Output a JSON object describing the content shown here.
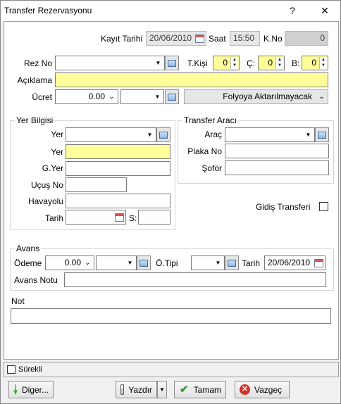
{
  "window": {
    "title": "Transfer Rezervasyonu",
    "help_glyph": "?",
    "close_glyph": "✕"
  },
  "header": {
    "kayit_tarihi_label": "Kayıt Tarihi",
    "kayit_tarihi_value": "20/06/2010",
    "saat_label": "Saat",
    "saat_value": "15:50",
    "kno_label": "K.No",
    "kno_value": "0"
  },
  "rez": {
    "rezno_label": "Rez No",
    "rezno_value": "",
    "tkisi_label": "T.Kişi",
    "tkisi_value": "0",
    "c_label": "Ç:",
    "c_value": "0",
    "b_label": "B:",
    "b_value": "0"
  },
  "aciklama": {
    "label": "Açıklama",
    "value": ""
  },
  "ucret": {
    "label": "Ücret",
    "amount": "0.00",
    "currency": "",
    "folyo_value": "Folyoya Aktarılmayacak"
  },
  "yer_bilgisi": {
    "title": "Yer Bilgisi",
    "yer_label": "Yer",
    "yer_select": "",
    "yer2_label": "Yer",
    "yer2_value": "",
    "gyer_label": "G.Yer",
    "gyer_value": "",
    "ucusno_label": "Uçuş No",
    "ucusno_value": "",
    "havayolu_label": "Havayolu",
    "havayolu_value": "",
    "tarih_label": "Tarih",
    "tarih_value": "",
    "s_label": "S:",
    "s_value": ""
  },
  "transfer_araci": {
    "title": "Transfer Aracı",
    "arac_label": "Araç",
    "arac_value": "",
    "plaka_label": "Plaka No",
    "plaka_value": "",
    "sofor_label": "Şoför",
    "sofor_value": ""
  },
  "gidis": {
    "label": "Gidiş Transferi",
    "checked": false
  },
  "avans": {
    "title": "Avans",
    "odeme_label": "Ödeme",
    "odeme_amount": "0.00",
    "odeme_currency": "",
    "otipi_label": "Ö.Tipi",
    "otipi_value": "",
    "tarih_label": "Tarih",
    "tarih_value": "20/06/2010",
    "notu_label": "Avans Notu",
    "notu_value": ""
  },
  "not": {
    "label": "Not",
    "value": ""
  },
  "surekli": {
    "label": "Sürekli",
    "checked": false
  },
  "buttons": {
    "diger": "Diger...",
    "yazdir": "Yazdır",
    "tamam": "Tamam",
    "vazgec": "Vazgeç"
  },
  "colors": {
    "required_field": "#ffff99",
    "disabled_field": "#e6e6e6"
  }
}
